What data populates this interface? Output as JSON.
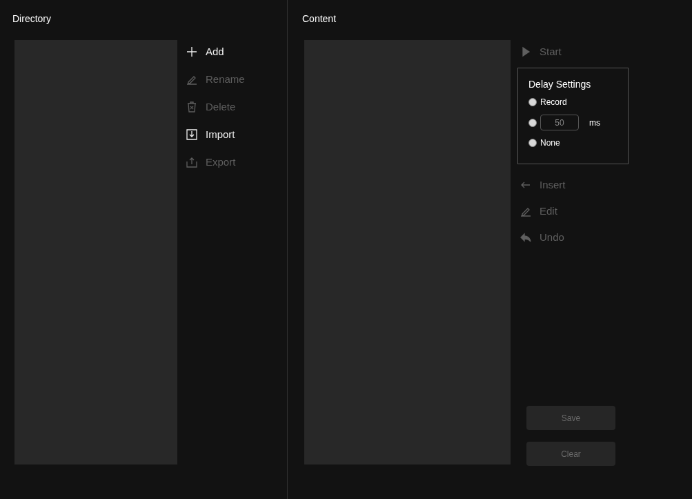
{
  "directory": {
    "title": "Directory",
    "actions": [
      {
        "kind": "add",
        "label": "Add",
        "disabled": false
      },
      {
        "kind": "rename",
        "label": "Rename",
        "disabled": true
      },
      {
        "kind": "delete",
        "label": "Delete",
        "disabled": true
      },
      {
        "kind": "import",
        "label": "Import",
        "disabled": false
      },
      {
        "kind": "export",
        "label": "Export",
        "disabled": true
      }
    ]
  },
  "content": {
    "title": "Content",
    "start": {
      "kind": "start",
      "label": "Start",
      "disabled": true
    },
    "delay_settings": {
      "title": "Delay Settings",
      "options": [
        {
          "kind": "label",
          "label": "Record",
          "selected": false
        },
        {
          "kind": "input",
          "value": "50",
          "unit": "ms",
          "selected": false
        },
        {
          "kind": "label",
          "label": "None",
          "selected": false
        }
      ]
    },
    "actions": [
      {
        "kind": "insert",
        "label": "Insert",
        "disabled": true
      },
      {
        "kind": "edit",
        "label": "Edit",
        "disabled": true
      },
      {
        "kind": "undo",
        "label": "Undo",
        "disabled": true
      }
    ],
    "buttons": [
      {
        "label": "Save",
        "disabled": true
      },
      {
        "label": "Clear",
        "disabled": true
      }
    ]
  }
}
